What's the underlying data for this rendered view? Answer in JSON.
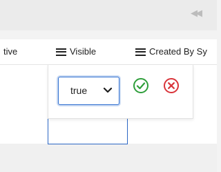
{
  "toolbar": {
    "pager_prev_glyph": "◀◀"
  },
  "grid": {
    "columns": [
      {
        "label": "tive"
      },
      {
        "label": "Visible"
      },
      {
        "label": "Created By Sy"
      }
    ]
  },
  "editor": {
    "selected_value": "true",
    "options": [
      "true"
    ],
    "confirm_icon": "check-circle-icon",
    "cancel_icon": "x-circle-icon"
  },
  "colors": {
    "accent": "#2f6fd1",
    "confirm": "#2e9e3a",
    "cancel": "#d9343a"
  }
}
